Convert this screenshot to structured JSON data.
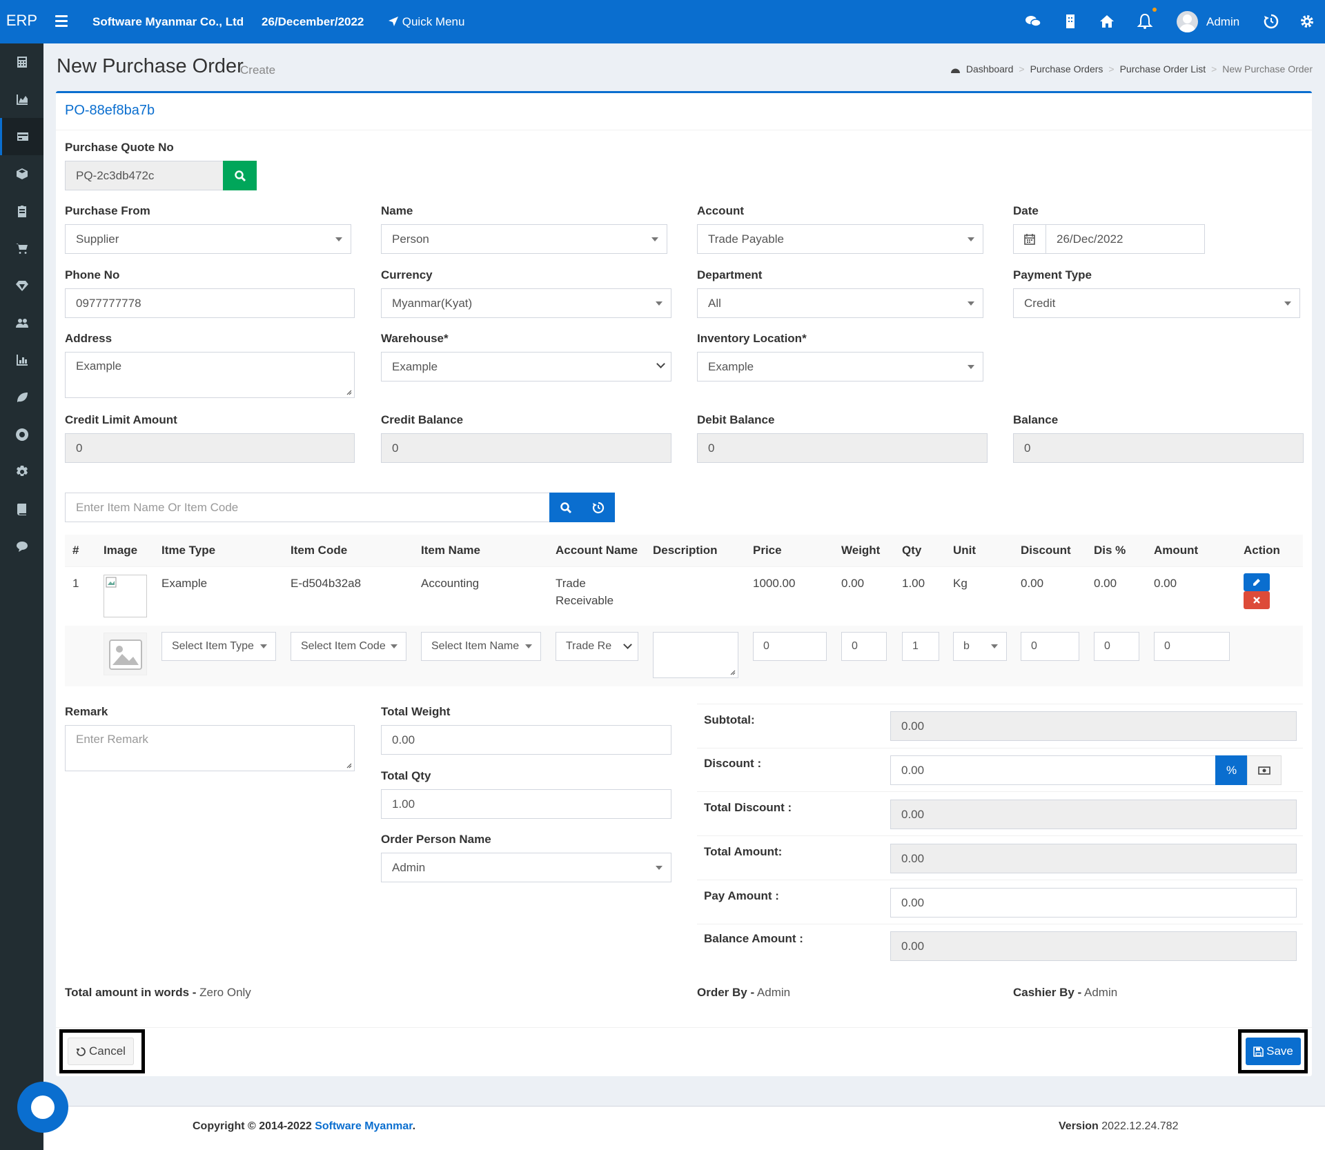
{
  "brand": "ERP",
  "header": {
    "company": "Software Myanmar Co., Ltd",
    "date": "26/December/2022",
    "quick_menu": "Quick Menu",
    "user": "Admin"
  },
  "sidebar": {
    "items": [
      "calculator-icon",
      "chart-area-icon",
      "credit-card-icon",
      "cube-icon",
      "clipboard-icon",
      "cart-icon",
      "diamond-icon",
      "users-icon",
      "bar-chart-icon",
      "leaf-icon",
      "life-ring-icon",
      "gear-icon",
      "book-icon",
      "comment-icon"
    ]
  },
  "page": {
    "title": "New Purchase Order",
    "subtitle": "Create"
  },
  "breadcrumb": [
    "Dashboard",
    "Purchase Orders",
    "Purchase Order List",
    "New Purchase Order"
  ],
  "po_number": "PO-88ef8ba7b",
  "form": {
    "purchase_quote_no": {
      "label": "Purchase Quote No",
      "value": "PQ-2c3db472c"
    },
    "purchase_from": {
      "label": "Purchase From",
      "value": "Supplier"
    },
    "name": {
      "label": "Name",
      "value": "Person"
    },
    "account": {
      "label": "Account",
      "value": "Trade Payable"
    },
    "date": {
      "label": "Date",
      "value": "26/Dec/2022"
    },
    "phone": {
      "label": "Phone No",
      "value": "0977777778"
    },
    "currency": {
      "label": "Currency",
      "value": "Myanmar(Kyat)"
    },
    "department": {
      "label": "Department",
      "value": "All"
    },
    "payment_type": {
      "label": "Payment Type",
      "value": "Credit"
    },
    "address": {
      "label": "Address",
      "value": "Example"
    },
    "warehouse": {
      "label": "Warehouse*",
      "value": "Example"
    },
    "inventory_location": {
      "label": "Inventory Location*",
      "value": "Example"
    },
    "credit_limit": {
      "label": "Credit Limit Amount",
      "value": "0"
    },
    "credit_balance": {
      "label": "Credit Balance",
      "value": "0"
    },
    "debit_balance": {
      "label": "Debit Balance",
      "value": "0"
    },
    "balance": {
      "label": "Balance",
      "value": "0"
    }
  },
  "item_search": {
    "placeholder": "Enter Item Name Or Item Code"
  },
  "table": {
    "headers": [
      "#",
      "Image",
      "Itme Type",
      "Item Code",
      "Item Name",
      "Account Name",
      "Description",
      "Price",
      "Weight",
      "Qty",
      "Unit",
      "Discount",
      "Dis %",
      "Amount",
      "Action"
    ],
    "rows": [
      {
        "no": "1",
        "type": "Example",
        "code": "E-d504b32a8",
        "name": "Accounting",
        "account_line1": "Trade",
        "account_line2": "Receivable",
        "description": "",
        "price": "1000.00",
        "weight": "0.00",
        "qty": "1.00",
        "unit": "Kg",
        "discount": "0.00",
        "dis_pct": "0.00",
        "amount": "0.00"
      }
    ],
    "entry": {
      "type": "Select Item Type",
      "code": "Select Item Code",
      "name": "Select Item Name",
      "account": "Trade Re",
      "price": "0",
      "weight": "0",
      "qty": "1",
      "unit": "b",
      "discount": "0",
      "dis_pct": "0",
      "amount": "0"
    }
  },
  "remark": {
    "label": "Remark",
    "placeholder": "Enter Remark"
  },
  "total_weight": {
    "label": "Total Weight",
    "value": "0.00"
  },
  "total_qty": {
    "label": "Total Qty",
    "value": "1.00"
  },
  "order_person": {
    "label": "Order Person Name",
    "value": "Admin"
  },
  "totals": {
    "subtotal": {
      "label": "Subtotal:",
      "value": "0.00"
    },
    "discount": {
      "label": "Discount :",
      "value": "0.00",
      "percent_btn": "%"
    },
    "total_discount": {
      "label": "Total Discount :",
      "value": "0.00"
    },
    "total_amount": {
      "label": "Total Amount:",
      "value": "0.00"
    },
    "pay_amount": {
      "label": "Pay Amount :",
      "value": "0.00"
    },
    "balance_amount": {
      "label": "Balance Amount :",
      "value": "0.00"
    }
  },
  "summary": {
    "words_label": "Total amount in words -",
    "words_value": " Zero Only",
    "order_by_label": "Order By -",
    "order_by_value": " Admin",
    "cashier_label": "Cashier By -",
    "cashier_value": " Admin"
  },
  "actions": {
    "cancel": "Cancel",
    "save": "Save"
  },
  "footer": {
    "copyright": "Copyright © 2014-2022 ",
    "company_link": "Software Myanmar",
    "period": ".",
    "version_label": "Version",
    "version_value": " 2022.12.24.782"
  },
  "colors": {
    "primary": "#0a6ecf",
    "success": "#00a65a",
    "danger": "#dd4b39",
    "sidebar": "#222d32"
  }
}
